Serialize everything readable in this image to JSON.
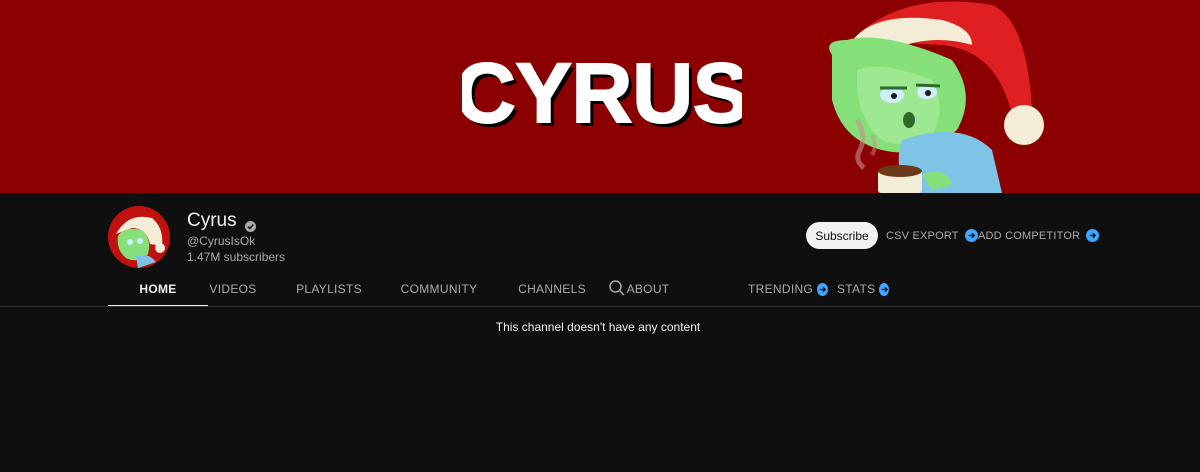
{
  "banner": {
    "title": "CYRUS",
    "background_color": "#8b0000"
  },
  "channel": {
    "name": "Cyrus",
    "verified_icon": "verified-check-icon",
    "handle": "@CyrusIsOk",
    "subscribers": "1.47M subscribers"
  },
  "actions": {
    "subscribe_label": "Subscribe",
    "csv_export_label": "CSV EXPORT",
    "add_competitor_label": "ADD COMPETITOR",
    "extension_icon": "play-circle-icon",
    "extension_color": "#3ea6ff"
  },
  "tabs": [
    {
      "label": "HOME",
      "active": true
    },
    {
      "label": "VIDEOS",
      "active": false
    },
    {
      "label": "PLAYLISTS",
      "active": false
    },
    {
      "label": "COMMUNITY",
      "active": false
    },
    {
      "label": "CHANNELS",
      "active": false
    },
    {
      "label": "ABOUT",
      "active": false
    },
    {
      "label": "TRENDING",
      "active": false
    },
    {
      "label": "STATS",
      "active": false
    }
  ],
  "search_icon": "search-icon",
  "content": {
    "empty_message": "This channel doesn't have any content"
  }
}
